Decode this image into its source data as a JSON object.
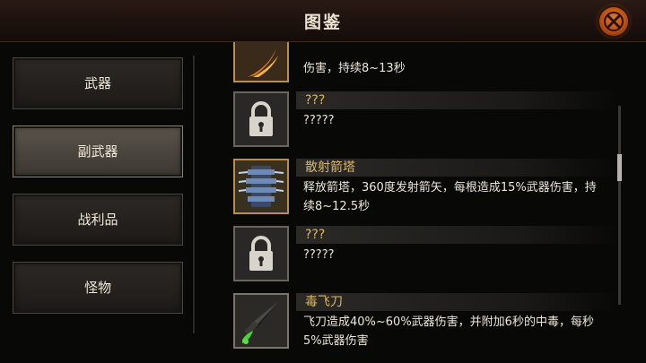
{
  "header": {
    "title": "图鉴"
  },
  "tabs": [
    {
      "label": "武器",
      "selected": false
    },
    {
      "label": "副武器",
      "selected": true
    },
    {
      "label": "战利品",
      "selected": false
    },
    {
      "label": "怪物",
      "selected": false
    }
  ],
  "items": [
    {
      "name": "",
      "desc_line2": "伤害，持续8~13秒",
      "icon": "flame-claw-icon"
    },
    {
      "name": "???",
      "desc": "?????",
      "icon": "padlock-icon",
      "locked": true
    },
    {
      "name": "散射箭塔",
      "desc": "释放箭塔，360度发射箭矢，每根造成15%武器伤害，持续8~12.5秒",
      "icon": "arrow-tower-icon"
    },
    {
      "name": "???",
      "desc": "?????",
      "icon": "padlock-icon",
      "locked": true
    },
    {
      "name": "毒飞刀",
      "desc": "飞刀造成40%~60%武器伤害，并附加6秒的中毒，每秒5%武器伤害",
      "icon": "poison-dagger-icon"
    }
  ],
  "colors": {
    "accent": "#d9b867",
    "close": "#c85a18"
  }
}
